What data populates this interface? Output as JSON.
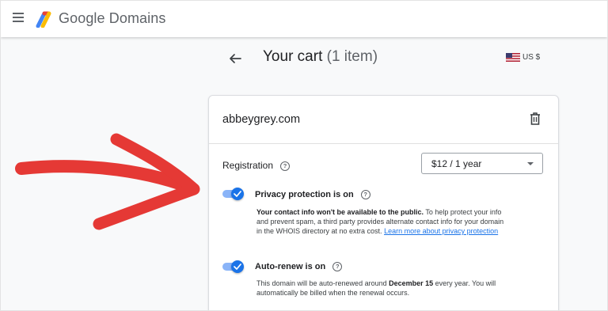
{
  "topbar": {
    "brand": "Google Domains",
    "menu_icon": "hamburger-menu-icon",
    "logo_icon": "google-domains-logo"
  },
  "header": {
    "title": "Your cart",
    "count": "(1 item)",
    "back_icon": "arrow-back-icon",
    "currency": "US $",
    "currency_flag": "us-flag-icon"
  },
  "cart": {
    "domain": "abbeygrey.com",
    "delete_icon": "trash-icon",
    "registration": {
      "label": "Registration",
      "help_glyph": "?",
      "selected_term": "$12 / 1 year"
    },
    "privacy": {
      "label": "Privacy protection is on",
      "enabled": true,
      "desc_bold": "Your contact info won't be available to the public.",
      "desc_text": " To help protect your info and prevent spam, a third party provides alternate contact info for your domain in the WHOIS directory at no extra cost. ",
      "desc_link": "Learn more about privacy protection"
    },
    "autorenew": {
      "label": "Auto-renew is on",
      "enabled": true,
      "desc_pre": "This domain will be auto-renewed around ",
      "desc_date": "December 15",
      "desc_post": " every year. You will automatically be billed when the renewal occurs."
    }
  },
  "annotation": {
    "arrow_color": "#e53935"
  },
  "colors": {
    "accent": "#1a73e8",
    "toggle_track": "#8ab4f8",
    "background": "#f8f9fa"
  }
}
